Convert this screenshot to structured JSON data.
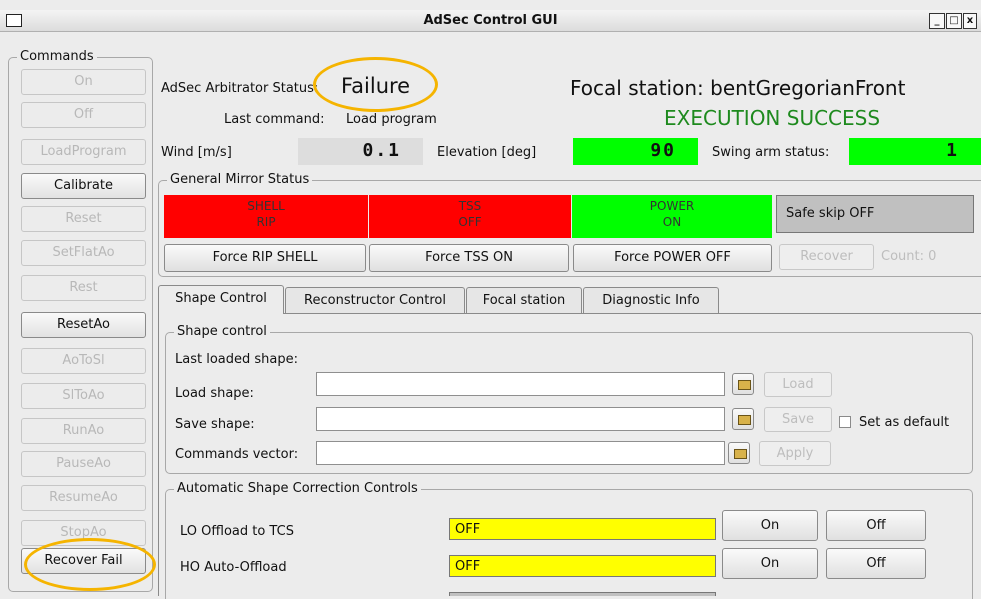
{
  "window": {
    "title": "AdSec Control GUI",
    "min": "_",
    "max": "□",
    "close": "x"
  },
  "commands": {
    "title": "Commands",
    "buttons": [
      "On",
      "Off",
      "LoadProgram",
      "Calibrate",
      "Reset",
      "SetFlatAo",
      "Rest",
      "ResetAo",
      "AoToSl",
      "SlToAo",
      "RunAo",
      "PauseAo",
      "ResumeAo",
      "StopAo",
      "Recover Fail"
    ],
    "enabled": [
      false,
      false,
      false,
      true,
      false,
      false,
      false,
      true,
      false,
      false,
      false,
      false,
      false,
      false,
      true
    ]
  },
  "header": {
    "arbitrator_label": "AdSec Arbitrator Status:",
    "arbitrator_value": "Failure",
    "last_command_label": "Last command:",
    "last_command_value": "Load program",
    "focal_station": "Focal station: bentGregorianFront",
    "execution": "EXECUTION SUCCESS",
    "wind_label": "Wind [m/s]",
    "wind_value": "0.1",
    "elevation_label": "Elevation [deg]",
    "elevation_value": "90",
    "swing_label": "Swing arm status:",
    "swing_value": "1"
  },
  "mirror": {
    "title": "General Mirror Status",
    "shell_title": "SHELL",
    "shell_state": "RIP",
    "tss_title": "TSS",
    "tss_state": "OFF",
    "power_title": "POWER",
    "power_state": "ON",
    "safe_skip": "Safe skip OFF",
    "force_rip": "Force RIP SHELL",
    "force_tss": "Force TSS ON",
    "force_power": "Force POWER OFF",
    "recover": "Recover",
    "count": "Count: 0"
  },
  "tabs": [
    "Shape Control",
    "Reconstructor Control",
    "Focal station",
    "Diagnostic Info"
  ],
  "shape": {
    "title": "Shape control",
    "last_loaded": "Last loaded shape:",
    "load_label": "Load shape:",
    "save_label": "Save shape:",
    "cmdvec_label": "Commands vector:",
    "load_btn": "Load",
    "save_btn": "Save",
    "apply_btn": "Apply",
    "set_default": "Set as default"
  },
  "asc": {
    "title": "Automatic Shape Correction Controls",
    "lo_label": "LO Offload to TCS",
    "lo_value": "OFF",
    "ho_label": "HO Auto-Offload",
    "ho_value": "OFF",
    "on": "On",
    "off": "Off"
  },
  "colors": {
    "red": "#ff0000",
    "green": "#00ff00",
    "yellow": "#ffff00",
    "gray": "#c0c0c0",
    "exec_green": "#1e8a1e",
    "highlight": "#f5b400"
  }
}
